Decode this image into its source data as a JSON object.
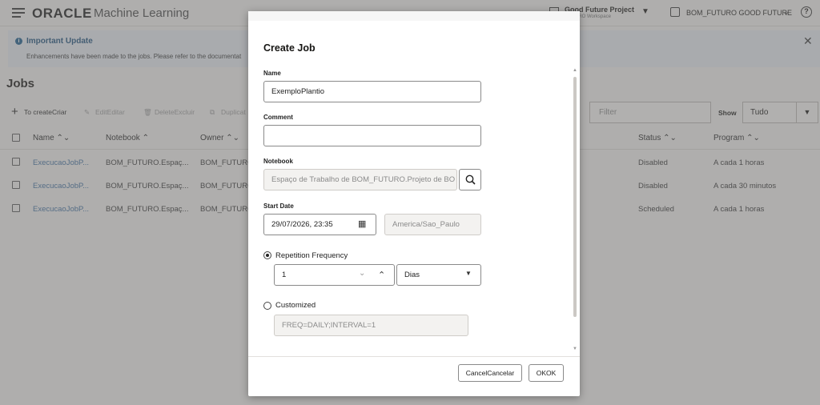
{
  "app": {
    "logo": "ORACLE",
    "product": "Machine Learning",
    "project_title": "Good Future Project",
    "project_sub": "...UTURO Workspace",
    "user": "BOM_FUTURO GOOD FUTURE",
    "help": "?"
  },
  "banner": {
    "title": "Important Update",
    "description": "Enhancements have been made to the jobs. Please refer to the documentat"
  },
  "page": {
    "title": "Jobs",
    "toolbar": [
      "To createCriar",
      "EditEditar",
      "DeleteExcluir",
      "Duplicat"
    ],
    "filter_placeholder": "Filter",
    "show_label": "Show",
    "show_value": "Tudo"
  },
  "table": {
    "columns": [
      "Name",
      "Notebook",
      "Owner",
      "Status",
      "Program"
    ],
    "rows": [
      {
        "name": "ExecucaoJobP...",
        "notebook": "BOM_FUTURO.Espaç...",
        "owner": "BOM_FUTURO",
        "status": "Disabled",
        "program": "A cada 1 horas"
      },
      {
        "name": "ExecucaoJobP...",
        "notebook": "BOM_FUTURO.Espaç...",
        "owner": "BOM_FUTURO",
        "status": "Disabled",
        "program": "A cada 30 minutos"
      },
      {
        "name": "ExecucaoJobP...",
        "notebook": "BOM_FUTURO.Espaç...",
        "owner": "BOM_FUTURO",
        "status": "Scheduled",
        "program": "A cada 1 horas"
      }
    ]
  },
  "dialog": {
    "title": "Create Job",
    "name_label": "Name",
    "name_value": "ExemploPlantio",
    "comment_label": "Comment",
    "comment_value": "",
    "notebook_label": "Notebook",
    "notebook_value": "Espaço de Trabalho de BOM_FUTURO.Projeto de BO",
    "start_date_label": "Start Date",
    "start_date_value": "29/07/2026, 23:35",
    "timezone_value": "America/Sao_Paulo",
    "repetition_label": "Repetition Frequency",
    "repetition_value": "1",
    "repetition_unit": "Dias",
    "customized_label": "Customized",
    "customized_value": "FREQ=DAILY;INTERVAL=1",
    "cancel_label": "CancelCancelar",
    "ok_label": "OKOK"
  }
}
